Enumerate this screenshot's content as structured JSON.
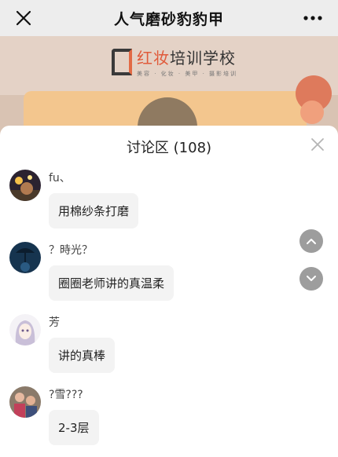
{
  "navbar": {
    "title": "人气磨砂豹豹甲",
    "close_icon": "close-icon",
    "more_icon": "more-icon"
  },
  "video": {
    "school_name_part1": "红妆",
    "school_name_part2": "培训学校",
    "school_tagline": "美容 · 化妆 · 美甲 · 摄影培训",
    "play_icon": "play-icon"
  },
  "discussion": {
    "title": "讨论区 (108)",
    "close_icon": "close-icon",
    "comments": [
      {
        "author": "fu、",
        "text": "用棉纱条打磨",
        "avatar": "avatar-night-street"
      },
      {
        "author": "？時光？",
        "text": "圈圈老师讲的真温柔",
        "avatar": "avatar-umbrella-blue"
      },
      {
        "author": "芳",
        "text": "讲的真棒",
        "avatar": "avatar-anime-girl"
      },
      {
        "author": "?雪???",
        "text": "2-3层",
        "avatar": "avatar-family-photo"
      }
    ],
    "scroll_up_icon": "chevron-up-icon",
    "scroll_down_icon": "chevron-down-icon"
  },
  "colors": {
    "accent": "#e05a3a",
    "sheet_bg": "#ffffff",
    "bubble_bg": "#f3f3f3",
    "scroll_btn": "#9d9d9d"
  }
}
